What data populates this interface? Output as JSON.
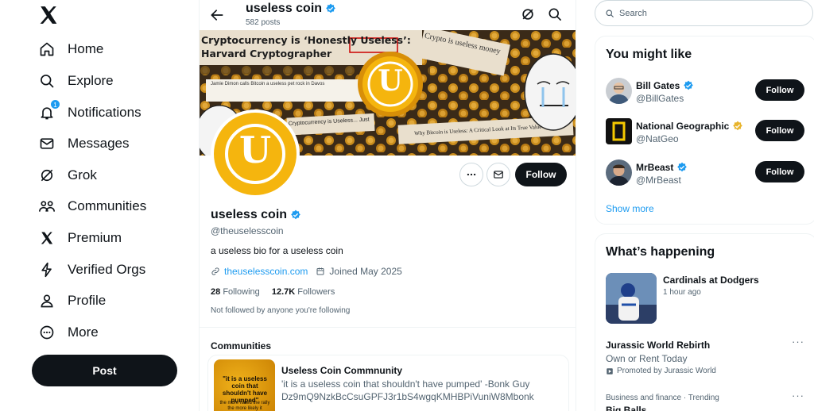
{
  "nav": {
    "items": [
      {
        "label": "Home",
        "icon": "home-icon"
      },
      {
        "label": "Explore",
        "icon": "search-icon"
      },
      {
        "label": "Notifications",
        "icon": "bell-icon",
        "badge": "1"
      },
      {
        "label": "Messages",
        "icon": "mail-icon"
      },
      {
        "label": "Grok",
        "icon": "grok-icon"
      },
      {
        "label": "Communities",
        "icon": "communities-icon"
      },
      {
        "label": "Premium",
        "icon": "x-logo-icon"
      },
      {
        "label": "Verified Orgs",
        "icon": "lightning-icon"
      },
      {
        "label": "Profile",
        "icon": "person-icon"
      },
      {
        "label": "More",
        "icon": "more-circle-icon"
      }
    ],
    "post_label": "Post"
  },
  "header": {
    "title": "useless coin",
    "posts": "582 posts"
  },
  "banner": {
    "headline": "Cryptocurrency is ‘Honestly Useless’: Harvard Cryptographer",
    "clip_top": "Crypto is useless money",
    "clip_mid": "Jamie Dimon calls Bitcoin a useless pet rock in Davos",
    "clip_crypto": "Cryptocurrency is Useless... Just a",
    "clip_bottom": "Why Bitcoin is Useless: A Critical Look at Its True Value",
    "coin_letter": "U"
  },
  "profile": {
    "name": "useless coin",
    "handle": "@theuselesscoin",
    "bio": "a useless bio for a useless coin",
    "website": "theuselesscoin.com",
    "joined": "Joined May 2025",
    "following_count": "28",
    "following_label": "Following",
    "followers_count": "12.7K",
    "followers_label": "Followers",
    "not_followed": "Not followed by anyone you're following",
    "follow_label": "Follow"
  },
  "communities": {
    "heading": "Communities",
    "name": "Useless Coin Commnunity",
    "description": "'it is a useless coin that shouldn't have pumped' -Bonk Guy Dz9mQ9NzkBcCsuGPFJ3r1bS4wgqKMHBPiVuniW8Mbonk",
    "thumb_quote": "\"it is a useless coin that shouldn't have pumped\"",
    "thumb_sub": "the more hated the rally the more likely it"
  },
  "search": {
    "placeholder": "Search"
  },
  "who_to_follow": {
    "title": "You might like",
    "accounts": [
      {
        "name": "Bill Gates",
        "handle": "@BillGates",
        "badge": "blue"
      },
      {
        "name": "National Geographic",
        "handle": "@NatGeo",
        "badge": "gold"
      },
      {
        "name": "MrBeast",
        "handle": "@MrBeast",
        "badge": "blue"
      }
    ],
    "follow_label": "Follow",
    "show_more": "Show more"
  },
  "happening": {
    "title": "What’s happening",
    "event_title": "Cardinals at Dodgers",
    "event_time": "1 hour ago",
    "promo_title": "Jurassic World Rebirth",
    "promo_sub": "Own or Rent Today",
    "promo_by": "Promoted by Jurassic World",
    "trend_category": "Business and finance · Trending",
    "trend_title": "Big Balls"
  },
  "colors": {
    "accent": "#1d9bf0",
    "dark": "#0f1419",
    "muted": "#536471",
    "coin_gold": "#f5b50e",
    "gold_badge": "#e8b42c"
  }
}
